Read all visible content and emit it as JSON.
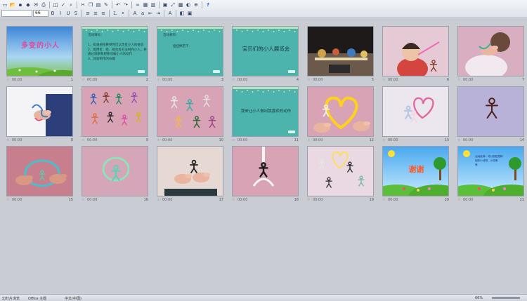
{
  "toolbar": {
    "zoom": "66",
    "row1_icons": [
      "new-icon",
      "open-icon",
      "save-icon",
      "permission-icon",
      "email-icon",
      "print-icon",
      "print-preview-icon",
      "spelling-icon",
      "research-icon",
      "cut-icon",
      "copy-icon",
      "paste-icon",
      "format-painter-icon",
      "undo-icon",
      "redo-icon",
      "hyperlink-icon",
      "table-icon",
      "chart-icon",
      "insert-new-slide-icon",
      "expand-icon",
      "grid-icon",
      "color-icon",
      "zoom-in-icon",
      "help-icon"
    ],
    "row2_icons": [
      "bold-icon",
      "italic-icon",
      "underline-icon",
      "shadow-icon",
      "align-left-icon",
      "align-center-icon",
      "align-right-icon",
      "numbering-icon",
      "bullets-icon",
      "increase-font-icon",
      "decrease-font-icon",
      "decrease-indent-icon",
      "increase-indent-icon",
      "font-color-icon",
      "design-icon",
      "new-slide-icon"
    ]
  },
  "slides": [
    {
      "num": "1",
      "duration": "00:00",
      "type": "title",
      "title": "多变的小人"
    },
    {
      "num": "2",
      "duration": "00:00",
      "type": "teal-list",
      "heading": "活动目标：",
      "lines": [
        "1、知道扭扭棒弹性可以改变小人的姿态",
        "2、能用折、绕、接合等方法制作小人，并",
        "   通过观察和想象创编小人的动作",
        "3、体验制作的乐趣"
      ]
    },
    {
      "num": "3",
      "duration": "00:00",
      "type": "teal-list",
      "heading": "活动材料：",
      "lines": [
        "扭扭棒若干"
      ]
    },
    {
      "num": "4",
      "duration": "00:00",
      "type": "teal-title",
      "title": "宝贝们的小人展览会"
    },
    {
      "num": "5",
      "duration": "00:00",
      "type": "photo",
      "scene": "classroom"
    },
    {
      "num": "6",
      "duration": "00:00",
      "type": "photo",
      "scene": "child-pipe"
    },
    {
      "num": "7",
      "duration": "00:00",
      "type": "photo",
      "scene": "child-hands"
    },
    {
      "num": "8",
      "duration": "00:00",
      "type": "photo",
      "scene": "hands-twist"
    },
    {
      "num": "9",
      "duration": "00:00",
      "type": "photo",
      "scene": "figures-many"
    },
    {
      "num": "10",
      "duration": "00:00",
      "type": "photo",
      "scene": "figures-few"
    },
    {
      "num": "11",
      "duration": "00:00",
      "type": "teal-title",
      "title": "我来让小人做出我喜欢的动作"
    },
    {
      "num": "12",
      "duration": "00:00",
      "type": "photo",
      "scene": "heart-hands"
    },
    {
      "num": "13",
      "duration": "00:00",
      "type": "photo",
      "scene": "heart-figures"
    },
    {
      "num": "14",
      "duration": "00:00",
      "type": "photo",
      "scene": "single-figure"
    },
    {
      "num": "15",
      "duration": "00:00",
      "type": "photo",
      "scene": "ring-hands"
    },
    {
      "num": "16",
      "duration": "00:00",
      "type": "photo",
      "scene": "ring-figure"
    },
    {
      "num": "17",
      "duration": "00:00",
      "type": "photo",
      "scene": "hands-dark-figure"
    },
    {
      "num": "18",
      "duration": "00:00",
      "type": "photo",
      "scene": "hanging-figure"
    },
    {
      "num": "19",
      "duration": "00:00",
      "type": "photo",
      "scene": "hanging-group"
    },
    {
      "num": "20",
      "duration": "00:00",
      "type": "cartoon",
      "title": "谢谢"
    },
    {
      "num": "21",
      "duration": "00:00",
      "type": "cartoon-text",
      "lines": [
        "活动延伸：可以用扭扭棒",
        "制作小动物、小花等",
        "等"
      ]
    }
  ],
  "status": {
    "view": "幻灯片浏览",
    "theme": "Office 主题",
    "language": "中文(中国)",
    "zoom": "66%"
  }
}
